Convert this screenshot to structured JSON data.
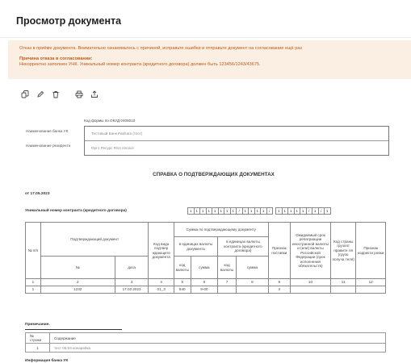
{
  "page": {
    "title": "Просмотр документа"
  },
  "alert": {
    "message": "Отказ в приёме документа. Внимательно ознакомьтесь с причиной, исправьте ошибки и отправьте документ на согласование ещё раз",
    "reason_title": "Причина отказа в согласовании:",
    "reason_text": "Некорректно заполнен УНК. Уникальный номер контракта (кредитного договора) должен быть 123456/1243/43675."
  },
  "toolbar": {
    "icons": [
      "copy-icon",
      "edit-icon",
      "delete-icon",
      "print-icon",
      "share-icon"
    ]
  },
  "document": {
    "okud": "Код формы по ОКУД 0406010",
    "bank_label": "Наименование банка УК",
    "bank_value": "Тестовый Банк Pakhara (тест)",
    "resident_label": "Наименование резидента",
    "resident_value": "Орг1 Ресурс RSA Invoice",
    "heading": "СПРАВКА О ПОДТВЕРЖДАЮЩИХ ДОКУМЕНТАХ",
    "date": "от 17.05.2023",
    "unk_label": "Уникальный номер контракта (кредитного договора)",
    "unk_cells": [
      "1",
      "1",
      "1",
      "1",
      "1",
      "1",
      "1",
      "1",
      "/",
      "1",
      "1",
      "1",
      "1",
      "/",
      "1",
      "1",
      "1",
      "1",
      "1",
      "/",
      "1",
      "/",
      "1"
    ],
    "table": {
      "h_num": "№ п/п",
      "h_doc": "Подтверждающий документ",
      "h_doc_num": "№",
      "h_doc_date": "дата",
      "h_kind": "Код вида подтвер ждающего документа",
      "h_sum": "Сумма по подтверждающему документу",
      "h_sum_doc": "в единицах валюты документа",
      "h_sum_contract": "в единицах валюты контракта (кредитного договора)",
      "h_code": "код валюты",
      "h_amount": "сумма",
      "h_code2": "код валюты",
      "h_amount2": "сумма",
      "h_supply": "Признак поставки",
      "h_term": "Ожидаемый срок репатриации иностранной валюты и (или) валюты Российской Федерации (срок исполнения обязательств)",
      "h_country": "Код страны грузоот правите ля (грузо получа теля)",
      "h_correction": "Признак корректи ровки",
      "colnums": [
        "1",
        "2",
        "3",
        "4",
        "5",
        "6",
        "7",
        "8",
        "9",
        "10",
        "11",
        "12"
      ],
      "rows": [
        [
          "1",
          "1232",
          "17.02.2023",
          "01_3",
          "840",
          "9-00",
          "",
          "",
          "3",
          "",
          "",
          ""
        ]
      ]
    },
    "note_title": "Примечание.",
    "note_table": {
      "h_row": "№ строки",
      "h_content": "Содержание",
      "rows": [
        {
          "row": "1",
          "content": "тест 05:04 конарейка"
        }
      ]
    },
    "bank_info_title": "Информация банка УК"
  }
}
